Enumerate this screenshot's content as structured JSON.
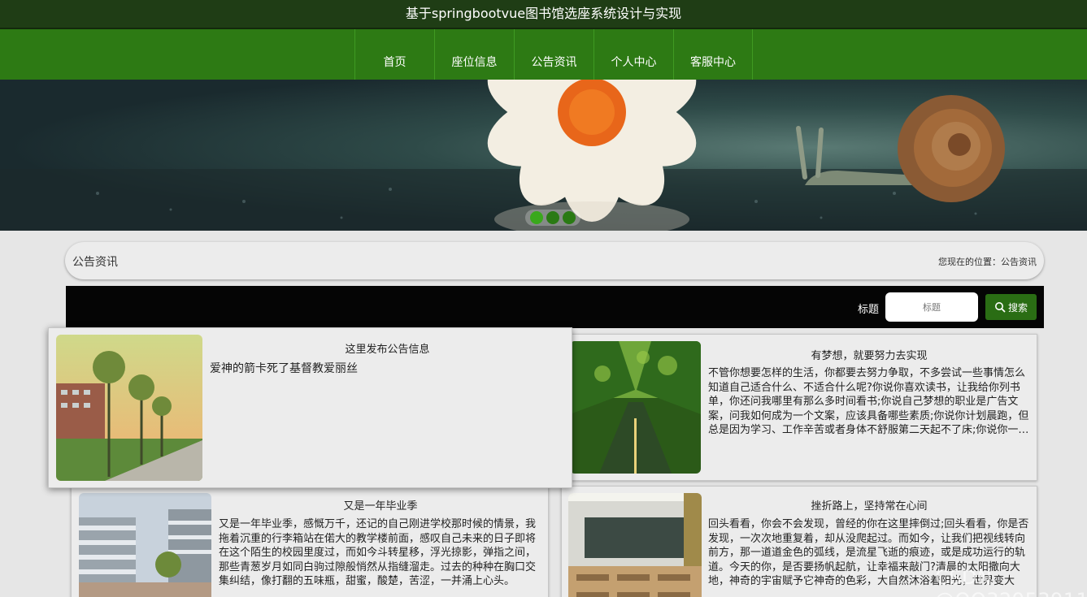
{
  "header": {
    "site_title": "基于springbootvue图书馆选座系统设计与实现"
  },
  "nav": {
    "items": [
      "首页",
      "座位信息",
      "公告资讯",
      "个人中心",
      "客服中心"
    ]
  },
  "banner": {
    "dots": 3,
    "active_dot": 1
  },
  "breadcrumb": {
    "title": "公告资讯",
    "location": "您现在的位置：公告资讯"
  },
  "search": {
    "label": "标题",
    "placeholder": "标题",
    "button_label": "搜索"
  },
  "cards": [
    {
      "title": "这里发布公告信息",
      "body": "爱神的箭卡死了基督教爱丽丝",
      "image": "campus-street-photo"
    },
    {
      "title": "有梦想，就要努力去实现",
      "body": "不管你想要怎样的生活，你都要去努力争取，不多尝试一些事情怎么知道自己适合什么、不适合什么呢?你说你喜欢读书，让我给你列书单，你还问我哪里有那么多时间看书;你说自己梦想的职业是广告文案，问我如何成为一个文案，应该具备哪些素质;你说你计划晨跑，但总是因为学习、工作辛苦或者身体不舒服第二天起不了床;你说你一…",
      "image": "tree-lined-path-photo"
    },
    {
      "title": "又是一年毕业季",
      "body": "又是一年毕业季，感慨万千，还记的自己刚进学校那时候的情景，我拖着沉重的行李箱站在偌大的教学楼前面，感叹自己未来的日子即将在这个陌生的校园里度过，而如今斗转星移，浮光掠影，弹指之间，那些青葱岁月如同白驹过隙般悄然从指缝溜走。过去的种种在胸口交集纠结，像打翻的五味瓶，甜蜜，酸楚，苦涩，一并涌上心头。",
      "image": "school-building-photo"
    },
    {
      "title": "挫折路上，坚持常在心间",
      "body": "回头看看，你会不会发现，曾经的你在这里摔倒过;回头看看，你是否发现，一次次地重复着，却从没爬起过。而如今，让我们把视线转向前方，那一道道金色的弧线，是流星飞逝的痕迹，或是成功运行的轨道。今天的你，是否要扬帆起航，让幸福来敲门?清晨的太阳撒向大地，神奇的宇宙赋予它神奇的色彩，大自然沐浴着阳光，世界变大",
      "image": "classroom-photo"
    }
  ],
  "watermark": "CSDN @QQ3295391197"
}
